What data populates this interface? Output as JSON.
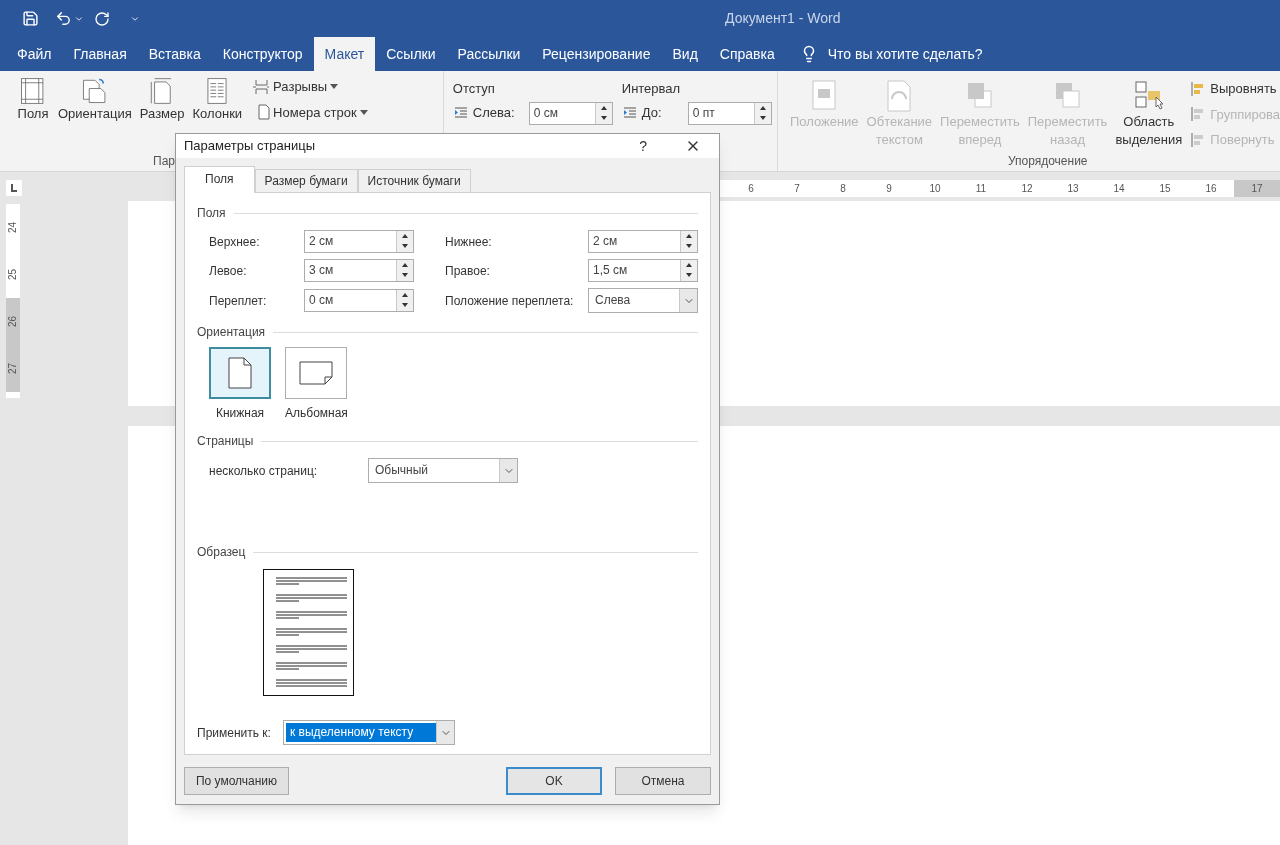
{
  "window": {
    "title": "Документ1  -  Word"
  },
  "menu_tabs": [
    {
      "label": "Файл",
      "selected": false
    },
    {
      "label": "Главная",
      "selected": false
    },
    {
      "label": "Вставка",
      "selected": false
    },
    {
      "label": "Конструктор",
      "selected": false
    },
    {
      "label": "Макет",
      "selected": true
    },
    {
      "label": "Ссылки",
      "selected": false
    },
    {
      "label": "Рассылки",
      "selected": false
    },
    {
      "label": "Рецензирование",
      "selected": false
    },
    {
      "label": "Вид",
      "selected": false
    },
    {
      "label": "Справка",
      "selected": false
    }
  ],
  "tell_me": "Что вы хотите сделать?",
  "ribbon": {
    "page_setup": {
      "big_buttons": [
        {
          "label": "Поля",
          "kind": "margins"
        },
        {
          "label": "Ориентация",
          "kind": "orientation"
        },
        {
          "label": "Размер",
          "kind": "size"
        },
        {
          "label": "Колонки",
          "kind": "columns"
        }
      ],
      "small_buttons": [
        {
          "label": "Разрывы",
          "kind": "breaks"
        },
        {
          "label": "Номера строк",
          "kind": "numbers"
        }
      ],
      "group_label": "Пар"
    },
    "indent": {
      "title": "Отступ",
      "fields": [
        {
          "label": "Слева:",
          "value": "0 см"
        }
      ]
    },
    "spacing": {
      "title": "Интервал",
      "fields": [
        {
          "label": "До:",
          "value": "0 пт"
        }
      ]
    },
    "arrange": {
      "big_buttons": [
        {
          "lines": [
            "Положение"
          ],
          "disabled": true,
          "kind": "position"
        },
        {
          "lines": [
            "Обтекание",
            "текстом"
          ],
          "disabled": true,
          "kind": "wrap"
        },
        {
          "lines": [
            "Переместить",
            "вперед"
          ],
          "disabled": true,
          "kind": "forward"
        },
        {
          "lines": [
            "Переместить",
            "назад"
          ],
          "disabled": true,
          "kind": "backward"
        },
        {
          "lines": [
            "Область",
            "выделения"
          ],
          "disabled": false,
          "kind": "selection"
        }
      ],
      "small_buttons": [
        {
          "label": "Выровнять",
          "disabled": false
        },
        {
          "label": "Группирова",
          "disabled": true
        },
        {
          "label": "Повернуть",
          "disabled": true
        }
      ],
      "group_label": "Упорядочение"
    }
  },
  "rulers": {
    "horizontal": [
      "6",
      "7",
      "8",
      "9",
      "10",
      "11",
      "12",
      "13",
      "14",
      "15",
      "16",
      "17"
    ],
    "vertical": [
      "24",
      "25",
      "26",
      "27"
    ]
  },
  "dialog": {
    "title": "Параметры страницы",
    "help": "?",
    "tabs": [
      {
        "label": "Поля",
        "selected": true
      },
      {
        "label": "Размер бумаги",
        "selected": false
      },
      {
        "label": "Источник бумаги",
        "selected": false
      }
    ],
    "margins": {
      "title": "Поля",
      "fields": [
        {
          "label": "Верхнее:",
          "value": "2 см",
          "kind": "spin"
        },
        {
          "label": "Нижнее:",
          "value": "2 см",
          "kind": "spin"
        },
        {
          "label": "Левое:",
          "value": "3 см",
          "kind": "spin"
        },
        {
          "label": "Правое:",
          "value": "1,5 см",
          "kind": "spin"
        },
        {
          "label": "Переплет:",
          "value": "0 см",
          "kind": "spin"
        },
        {
          "label": "Положение переплета:",
          "value": "Слева",
          "kind": "select"
        }
      ]
    },
    "orientation": {
      "title": "Ориентация",
      "options": [
        {
          "label": "Книжная",
          "kind": "portrait",
          "selected": true
        },
        {
          "label": "Альбомная",
          "kind": "landscape",
          "selected": false
        }
      ]
    },
    "pages": {
      "title": "Страницы",
      "label": "несколько страниц:",
      "value": "Обычный"
    },
    "preview": {
      "title": "Образец"
    },
    "apply_to": {
      "label": "Применить к:",
      "value": "к выделенному тексту"
    },
    "buttons": [
      {
        "label": "По умолчанию",
        "default": false
      },
      {
        "label": "OK",
        "default": true
      },
      {
        "label": "Отмена",
        "default": false
      }
    ]
  }
}
